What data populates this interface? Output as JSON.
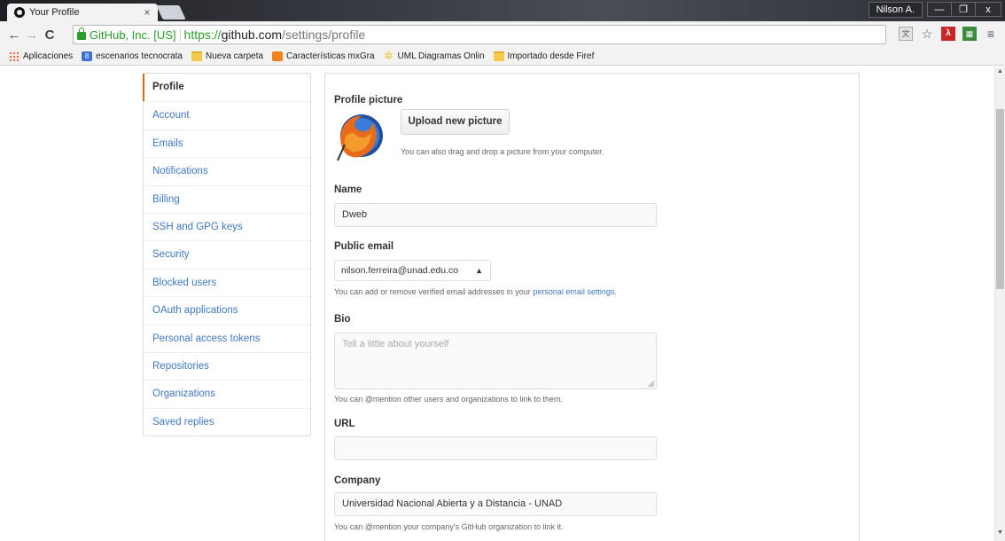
{
  "browser": {
    "tab_title": "Your Profile",
    "tab_close": "×",
    "window_user": "Nilson A.",
    "minimize": "—",
    "restore": "❐",
    "close": "x",
    "ev_badge": "GitHub, Inc. [US]",
    "url_scheme": "https://",
    "url_host": "github.com",
    "url_path": "/settings/profile"
  },
  "bookmarks": [
    {
      "label": "Aplicaciones"
    },
    {
      "label": "escenarios tecnocrata"
    },
    {
      "label": "Nueva carpeta"
    },
    {
      "label": "Características mxGra"
    },
    {
      "label": "UML Diagramas Onlin"
    },
    {
      "label": "Importado desde Firef"
    }
  ],
  "sidebar": {
    "items": [
      {
        "label": "Profile"
      },
      {
        "label": "Account"
      },
      {
        "label": "Emails"
      },
      {
        "label": "Notifications"
      },
      {
        "label": "Billing"
      },
      {
        "label": "SSH and GPG keys"
      },
      {
        "label": "Security"
      },
      {
        "label": "Blocked users"
      },
      {
        "label": "OAuth applications"
      },
      {
        "label": "Personal access tokens"
      },
      {
        "label": "Repositories"
      },
      {
        "label": "Organizations"
      },
      {
        "label": "Saved replies"
      }
    ]
  },
  "form": {
    "picture_label": "Profile picture",
    "upload_button": "Upload new picture",
    "upload_note": "You can also drag and drop a picture from your computer.",
    "name_label": "Name",
    "name_value": "Dweb",
    "email_label": "Public email",
    "email_value": "nilson.ferreira@unad.edu.co",
    "email_note": "You can add or remove verified email addresses in your",
    "email_note_link": "personal email settings.",
    "bio_label": "Bio",
    "bio_placeholder": "Tell a little about yourself",
    "bio_note": "You can @mention other users and organizations to link to them.",
    "url_label": "URL",
    "url_value": "",
    "company_label": "Company",
    "company_value": "Universidad Nacional Abierta y a Distancia - UNAD",
    "company_note": "You can @mention your company's GitHub organization to link it."
  },
  "colors": {
    "link": "#4078c0",
    "selected_accent": "#d26911",
    "secure_green": "#2c9c2c"
  }
}
